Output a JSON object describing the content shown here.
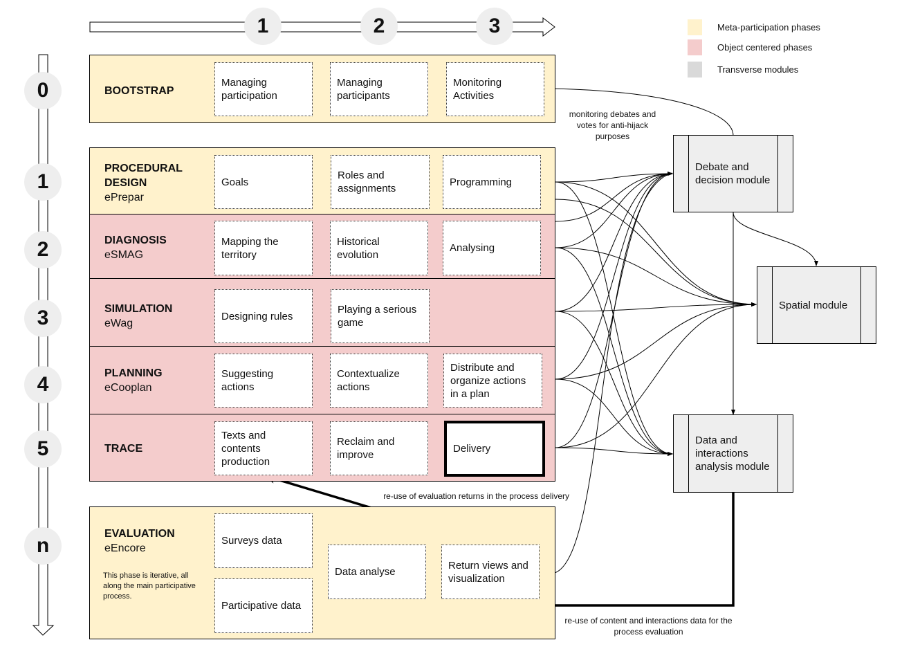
{
  "colors": {
    "meta_phase": "#fff2cc",
    "object_phase": "#f4cccc",
    "transverse_module": "#eeeeee"
  },
  "legend": {
    "items": [
      {
        "label": "Meta-participation phases",
        "color": "#fff2cc"
      },
      {
        "label": "Object centered phases",
        "color": "#f4cccc"
      },
      {
        "label": "Transverse modules",
        "color": "#eeeeee"
      }
    ]
  },
  "steps_axis": [
    "1",
    "2",
    "3"
  ],
  "phases_axis": [
    "0",
    "1",
    "2",
    "3",
    "4",
    "5",
    "n"
  ],
  "phases": {
    "bootstrap": {
      "title": "BOOTSTRAP",
      "tool": "",
      "tasks": [
        "Managing participation",
        "Managing participants",
        "Monitoring Activities"
      ]
    },
    "procedural": {
      "title1": "PROCEDURAL",
      "title2": "DESIGN",
      "tool": "ePrepar",
      "tasks": [
        "Goals",
        "Roles and assignments",
        "Programming"
      ]
    },
    "diagnosis": {
      "title": "DIAGNOSIS",
      "tool": "eSMAG",
      "tasks": [
        "Mapping the territory",
        "Historical evolution",
        "Analysing"
      ]
    },
    "simulation": {
      "title": "SIMULATION",
      "tool": "eWag",
      "tasks": [
        "Designing rules",
        "Playing a serious game"
      ]
    },
    "planning": {
      "title": "PLANNING",
      "tool": "eCooplan",
      "tasks": [
        "Suggesting actions",
        "Contextualize actions",
        "Distribute and organize actions in a plan"
      ]
    },
    "trace": {
      "title": "TRACE",
      "tool": "",
      "tasks": [
        "Texts and contents production",
        "Reclaim and improve",
        "Delivery"
      ]
    },
    "evaluation": {
      "title": "EVALUATION",
      "tool": "eEncore",
      "note": "This phase is iterative, all along the main participative process.",
      "tasks": [
        "Surveys data",
        "Participative data",
        "Data analyse",
        "Return views and visualization"
      ]
    }
  },
  "modules": {
    "debate": "Debate and decision module",
    "spatial": "Spatial module",
    "data": "Data and interactions analysis module"
  },
  "annotations": {
    "monitoring": "monitoring debates and votes for anti-hijack purposes",
    "reuse_eval": "re-use of evaluation returns in the process delivery",
    "reuse_content": "re-use of content and interactions data for the process evaluation"
  }
}
